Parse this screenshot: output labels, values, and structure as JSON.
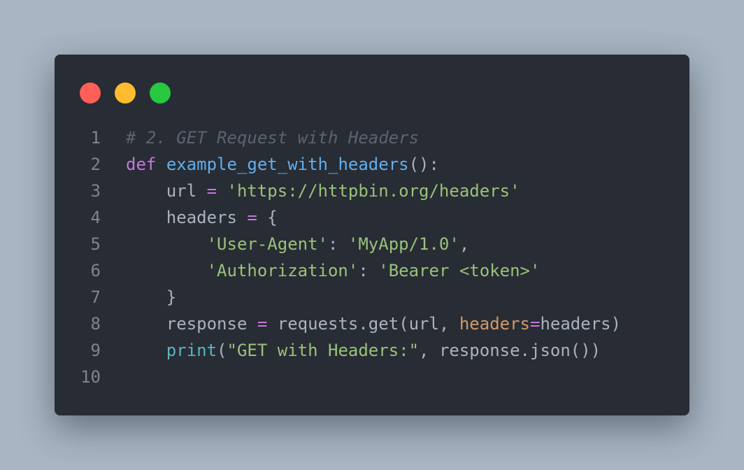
{
  "colors": {
    "background": "#a8b5c2",
    "editor_background": "#282c34",
    "window_close": "#ff5f57",
    "window_minimize": "#febc2e",
    "window_maximize": "#28c840",
    "line_number": "#7f848e",
    "comment": "#5c6370",
    "keyword": "#c678dd",
    "function": "#61afef",
    "text": "#abb2bf",
    "string": "#98c379",
    "builtin": "#56b6c2",
    "parameter": "#d19a66"
  },
  "window_controls": [
    "close",
    "minimize",
    "maximize"
  ],
  "code": {
    "lines": [
      {
        "number": "1",
        "tokens": [
          {
            "text": "# 2. GET Request with Headers",
            "kind": "comment"
          }
        ]
      },
      {
        "number": "2",
        "tokens": [
          {
            "text": "def",
            "kind": "keyword"
          },
          {
            "text": " ",
            "kind": "plain"
          },
          {
            "text": "example_get_with_headers",
            "kind": "func"
          },
          {
            "text": "():",
            "kind": "plain"
          }
        ]
      },
      {
        "number": "3",
        "tokens": [
          {
            "text": "    url ",
            "kind": "plain"
          },
          {
            "text": "=",
            "kind": "op"
          },
          {
            "text": " ",
            "kind": "plain"
          },
          {
            "text": "'https://httpbin.org/headers'",
            "kind": "string"
          }
        ]
      },
      {
        "number": "4",
        "tokens": [
          {
            "text": "    headers ",
            "kind": "plain"
          },
          {
            "text": "=",
            "kind": "op"
          },
          {
            "text": " {",
            "kind": "plain"
          }
        ]
      },
      {
        "number": "5",
        "tokens": [
          {
            "text": "        ",
            "kind": "plain"
          },
          {
            "text": "'User-Agent'",
            "kind": "string"
          },
          {
            "text": ": ",
            "kind": "plain"
          },
          {
            "text": "'MyApp/1.0'",
            "kind": "string"
          },
          {
            "text": ",",
            "kind": "plain"
          }
        ]
      },
      {
        "number": "6",
        "tokens": [
          {
            "text": "        ",
            "kind": "plain"
          },
          {
            "text": "'Authorization'",
            "kind": "string"
          },
          {
            "text": ": ",
            "kind": "plain"
          },
          {
            "text": "'Bearer <token>'",
            "kind": "string"
          }
        ]
      },
      {
        "number": "7",
        "tokens": [
          {
            "text": "    }",
            "kind": "plain"
          }
        ]
      },
      {
        "number": "8",
        "tokens": [
          {
            "text": "    response ",
            "kind": "plain"
          },
          {
            "text": "=",
            "kind": "op"
          },
          {
            "text": " requests.get(url, ",
            "kind": "plain"
          },
          {
            "text": "headers",
            "kind": "param"
          },
          {
            "text": "=",
            "kind": "op"
          },
          {
            "text": "headers)",
            "kind": "plain"
          }
        ]
      },
      {
        "number": "9",
        "tokens": [
          {
            "text": "    ",
            "kind": "plain"
          },
          {
            "text": "print",
            "kind": "builtin"
          },
          {
            "text": "(",
            "kind": "plain"
          },
          {
            "text": "\"GET with Headers:\"",
            "kind": "string"
          },
          {
            "text": ", response.json())",
            "kind": "plain"
          }
        ]
      },
      {
        "number": "10",
        "tokens": []
      }
    ]
  }
}
